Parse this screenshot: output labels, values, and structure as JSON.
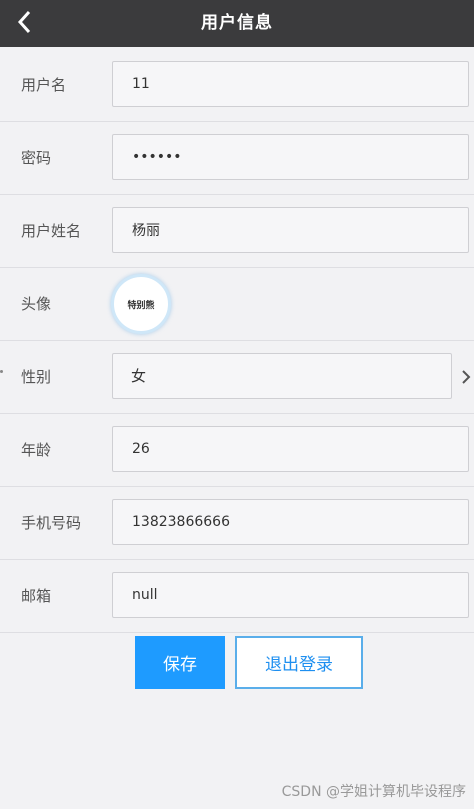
{
  "header": {
    "title": "用户信息",
    "back_icon": "chevron-left-icon"
  },
  "form": {
    "username": {
      "label": "用户名",
      "value": "11"
    },
    "password": {
      "label": "密码",
      "value": "••••••"
    },
    "realname": {
      "label": "用户姓名",
      "value": "杨丽"
    },
    "avatar": {
      "label": "头像",
      "image_text": "特别熊"
    },
    "gender": {
      "label": "性别",
      "value": "女",
      "caret_icon": "chevron-right-icon"
    },
    "age": {
      "label": "年龄",
      "value": "26"
    },
    "phone": {
      "label": "手机号码",
      "value": "13823866666"
    },
    "email": {
      "label": "邮箱",
      "value": "null"
    }
  },
  "actions": {
    "save_label": "保存",
    "logout_label": "退出登录"
  },
  "watermark": "CSDN @学姐计算机毕设程序",
  "colors": {
    "header_bg": "#3b3b3d",
    "primary": "#1e9bff",
    "page_bg": "#f2f2f4"
  }
}
